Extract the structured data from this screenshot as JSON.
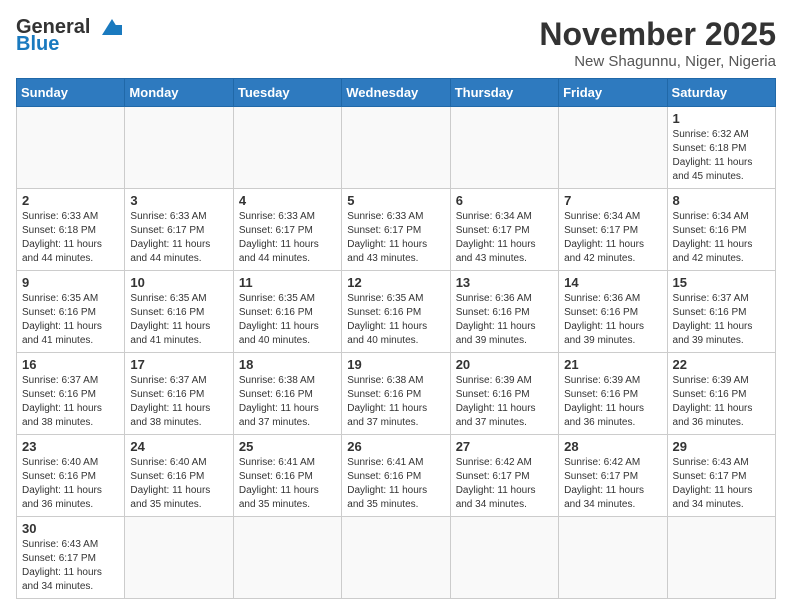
{
  "logo": {
    "text_general": "General",
    "text_blue": "Blue"
  },
  "title": {
    "month_year": "November 2025",
    "location": "New Shagunnu, Niger, Nigeria"
  },
  "headers": [
    "Sunday",
    "Monday",
    "Tuesday",
    "Wednesday",
    "Thursday",
    "Friday",
    "Saturday"
  ],
  "weeks": [
    [
      {
        "day": "",
        "info": ""
      },
      {
        "day": "",
        "info": ""
      },
      {
        "day": "",
        "info": ""
      },
      {
        "day": "",
        "info": ""
      },
      {
        "day": "",
        "info": ""
      },
      {
        "day": "",
        "info": ""
      },
      {
        "day": "1",
        "info": "Sunrise: 6:32 AM\nSunset: 6:18 PM\nDaylight: 11 hours\nand 45 minutes."
      }
    ],
    [
      {
        "day": "2",
        "info": "Sunrise: 6:33 AM\nSunset: 6:18 PM\nDaylight: 11 hours\nand 44 minutes."
      },
      {
        "day": "3",
        "info": "Sunrise: 6:33 AM\nSunset: 6:17 PM\nDaylight: 11 hours\nand 44 minutes."
      },
      {
        "day": "4",
        "info": "Sunrise: 6:33 AM\nSunset: 6:17 PM\nDaylight: 11 hours\nand 44 minutes."
      },
      {
        "day": "5",
        "info": "Sunrise: 6:33 AM\nSunset: 6:17 PM\nDaylight: 11 hours\nand 43 minutes."
      },
      {
        "day": "6",
        "info": "Sunrise: 6:34 AM\nSunset: 6:17 PM\nDaylight: 11 hours\nand 43 minutes."
      },
      {
        "day": "7",
        "info": "Sunrise: 6:34 AM\nSunset: 6:17 PM\nDaylight: 11 hours\nand 42 minutes."
      },
      {
        "day": "8",
        "info": "Sunrise: 6:34 AM\nSunset: 6:16 PM\nDaylight: 11 hours\nand 42 minutes."
      }
    ],
    [
      {
        "day": "9",
        "info": "Sunrise: 6:35 AM\nSunset: 6:16 PM\nDaylight: 11 hours\nand 41 minutes."
      },
      {
        "day": "10",
        "info": "Sunrise: 6:35 AM\nSunset: 6:16 PM\nDaylight: 11 hours\nand 41 minutes."
      },
      {
        "day": "11",
        "info": "Sunrise: 6:35 AM\nSunset: 6:16 PM\nDaylight: 11 hours\nand 40 minutes."
      },
      {
        "day": "12",
        "info": "Sunrise: 6:35 AM\nSunset: 6:16 PM\nDaylight: 11 hours\nand 40 minutes."
      },
      {
        "day": "13",
        "info": "Sunrise: 6:36 AM\nSunset: 6:16 PM\nDaylight: 11 hours\nand 39 minutes."
      },
      {
        "day": "14",
        "info": "Sunrise: 6:36 AM\nSunset: 6:16 PM\nDaylight: 11 hours\nand 39 minutes."
      },
      {
        "day": "15",
        "info": "Sunrise: 6:37 AM\nSunset: 6:16 PM\nDaylight: 11 hours\nand 39 minutes."
      }
    ],
    [
      {
        "day": "16",
        "info": "Sunrise: 6:37 AM\nSunset: 6:16 PM\nDaylight: 11 hours\nand 38 minutes."
      },
      {
        "day": "17",
        "info": "Sunrise: 6:37 AM\nSunset: 6:16 PM\nDaylight: 11 hours\nand 38 minutes."
      },
      {
        "day": "18",
        "info": "Sunrise: 6:38 AM\nSunset: 6:16 PM\nDaylight: 11 hours\nand 37 minutes."
      },
      {
        "day": "19",
        "info": "Sunrise: 6:38 AM\nSunset: 6:16 PM\nDaylight: 11 hours\nand 37 minutes."
      },
      {
        "day": "20",
        "info": "Sunrise: 6:39 AM\nSunset: 6:16 PM\nDaylight: 11 hours\nand 37 minutes."
      },
      {
        "day": "21",
        "info": "Sunrise: 6:39 AM\nSunset: 6:16 PM\nDaylight: 11 hours\nand 36 minutes."
      },
      {
        "day": "22",
        "info": "Sunrise: 6:39 AM\nSunset: 6:16 PM\nDaylight: 11 hours\nand 36 minutes."
      }
    ],
    [
      {
        "day": "23",
        "info": "Sunrise: 6:40 AM\nSunset: 6:16 PM\nDaylight: 11 hours\nand 36 minutes."
      },
      {
        "day": "24",
        "info": "Sunrise: 6:40 AM\nSunset: 6:16 PM\nDaylight: 11 hours\nand 35 minutes."
      },
      {
        "day": "25",
        "info": "Sunrise: 6:41 AM\nSunset: 6:16 PM\nDaylight: 11 hours\nand 35 minutes."
      },
      {
        "day": "26",
        "info": "Sunrise: 6:41 AM\nSunset: 6:16 PM\nDaylight: 11 hours\nand 35 minutes."
      },
      {
        "day": "27",
        "info": "Sunrise: 6:42 AM\nSunset: 6:17 PM\nDaylight: 11 hours\nand 34 minutes."
      },
      {
        "day": "28",
        "info": "Sunrise: 6:42 AM\nSunset: 6:17 PM\nDaylight: 11 hours\nand 34 minutes."
      },
      {
        "day": "29",
        "info": "Sunrise: 6:43 AM\nSunset: 6:17 PM\nDaylight: 11 hours\nand 34 minutes."
      }
    ],
    [
      {
        "day": "30",
        "info": "Sunrise: 6:43 AM\nSunset: 6:17 PM\nDaylight: 11 hours\nand 34 minutes."
      },
      {
        "day": "",
        "info": ""
      },
      {
        "day": "",
        "info": ""
      },
      {
        "day": "",
        "info": ""
      },
      {
        "day": "",
        "info": ""
      },
      {
        "day": "",
        "info": ""
      },
      {
        "day": "",
        "info": ""
      }
    ]
  ]
}
